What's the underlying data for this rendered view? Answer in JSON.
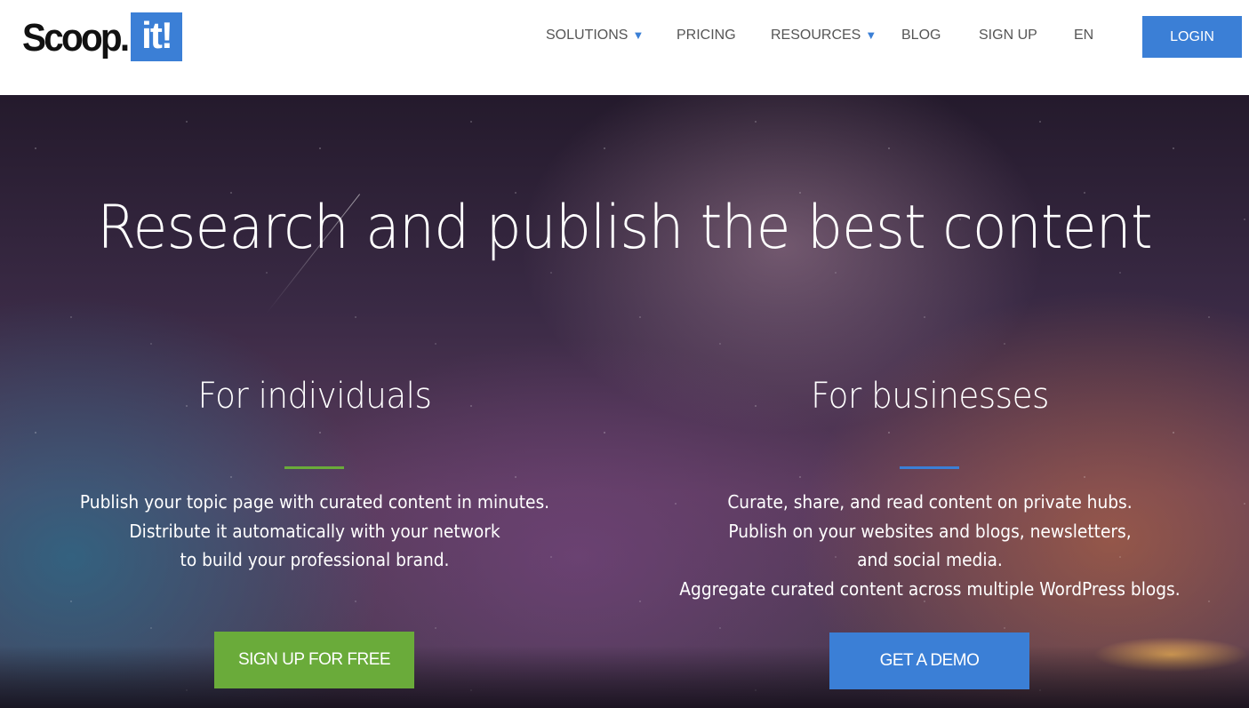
{
  "header": {
    "logo_text": "Scoop.",
    "logo_box_text": "it!",
    "nav": [
      {
        "label": "SOLUTIONS",
        "caret": "▼"
      },
      {
        "label": "PRICING"
      },
      {
        "label": "RESOURCES",
        "caret": "▼"
      },
      {
        "label": "BLOG"
      },
      {
        "label": "SIGN UP"
      },
      {
        "label": "EN"
      }
    ],
    "login_label": "LOGIN"
  },
  "hero": {
    "title": "Research and publish the best content",
    "individuals": {
      "title": "For individuals",
      "lines": [
        "Publish your topic page with curated content in minutes.",
        "Distribute it automatically with your network",
        "to build your professional brand."
      ],
      "cta": "SIGN UP FOR FREE"
    },
    "businesses": {
      "title": "For businesses",
      "lines": [
        "Curate, share, and read content on private hubs.",
        "Publish on your websites and blogs, newsletters,",
        "and social media.",
        "Aggregate curated content across multiple WordPress blogs."
      ],
      "cta": "GET A DEMO"
    }
  },
  "colors": {
    "accent_blue": "#3b7fd6",
    "accent_green": "#6aab3a",
    "nav_text": "#555555"
  }
}
